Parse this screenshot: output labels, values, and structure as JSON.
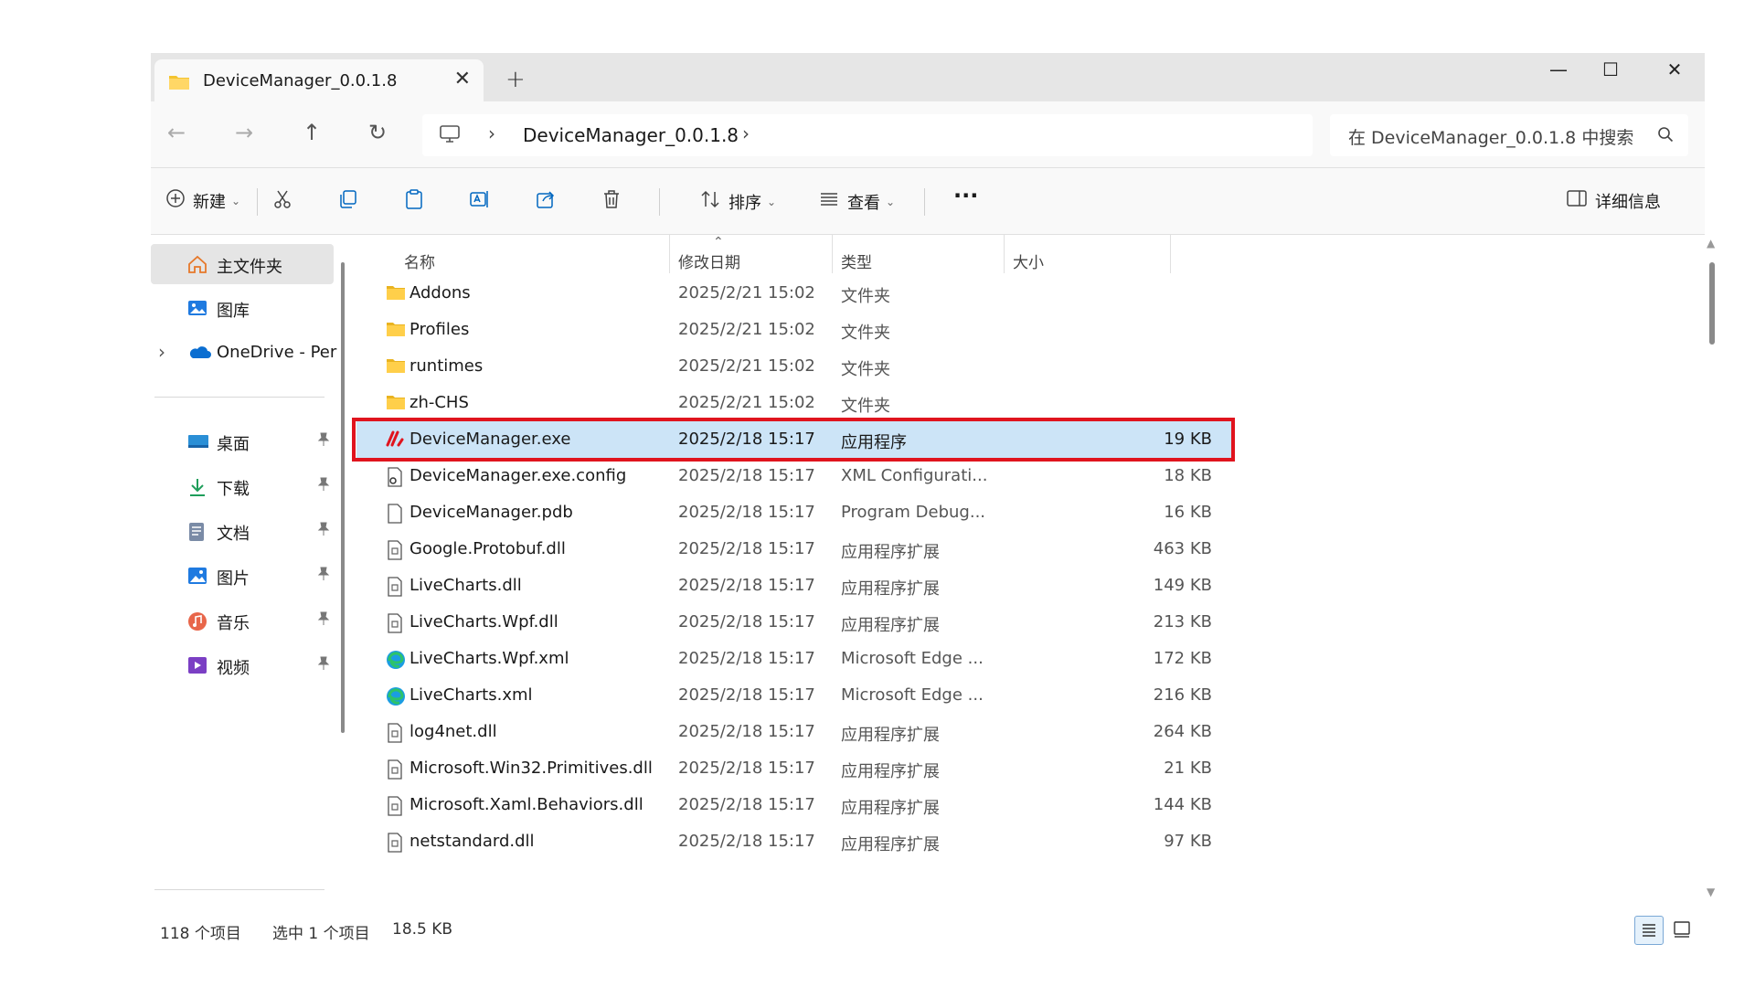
{
  "colors": {
    "selection": "#cce4f7",
    "highlight_border": "#e0141e",
    "folder": "#f4c430",
    "accent": "#0067c0"
  },
  "tab": {
    "title": "DeviceManager_0.0.1.8",
    "close": "✕",
    "new": "+"
  },
  "window_controls": {
    "minimize": "—",
    "maximize": "☐",
    "close": "✕"
  },
  "address": {
    "separator": "›",
    "crumb": "DeviceManager_0.0.1.8",
    "separator_end": "›"
  },
  "search": {
    "placeholder": "在 DeviceManager_0.0.1.8 中搜索"
  },
  "nav_buttons": {
    "back": "←",
    "forward": "→",
    "up": "↑",
    "refresh": "↻"
  },
  "commands": {
    "new": "新建",
    "sort": "排序",
    "view": "查看",
    "more": "···",
    "details": "详细信息"
  },
  "sidebar": {
    "home": "主文件夹",
    "gallery": "图库",
    "onedrive": "OneDrive - Per",
    "expand": "›",
    "quick": [
      {
        "label": "桌面",
        "icon": "desktop-icon"
      },
      {
        "label": "下载",
        "icon": "download-icon"
      },
      {
        "label": "文档",
        "icon": "documents-icon"
      },
      {
        "label": "图片",
        "icon": "pictures-icon"
      },
      {
        "label": "音乐",
        "icon": "music-icon"
      },
      {
        "label": "视频",
        "icon": "videos-icon"
      }
    ]
  },
  "columns": {
    "name": "名称",
    "modified": "修改日期",
    "type": "类型",
    "size": "大小"
  },
  "files": [
    {
      "name": "Addons",
      "date": "2025/2/21 15:02",
      "type": "文件夹",
      "size": "",
      "icon": "folder-icon"
    },
    {
      "name": "Profiles",
      "date": "2025/2/21 15:02",
      "type": "文件夹",
      "size": "",
      "icon": "folder-icon"
    },
    {
      "name": "runtimes",
      "date": "2025/2/21 15:02",
      "type": "文件夹",
      "size": "",
      "icon": "folder-icon"
    },
    {
      "name": "zh-CHS",
      "date": "2025/2/21 15:02",
      "type": "文件夹",
      "size": "",
      "icon": "folder-icon"
    },
    {
      "name": "DeviceManager.exe",
      "date": "2025/2/18 15:17",
      "type": "应用程序",
      "size": "19 KB",
      "icon": "app-exe-icon",
      "selected": true
    },
    {
      "name": "DeviceManager.exe.config",
      "date": "2025/2/18 15:17",
      "type": "XML Configurati...",
      "size": "18 KB",
      "icon": "config-file-icon"
    },
    {
      "name": "DeviceManager.pdb",
      "date": "2025/2/18 15:17",
      "type": "Program Debug...",
      "size": "16 KB",
      "icon": "blank-file-icon"
    },
    {
      "name": "Google.Protobuf.dll",
      "date": "2025/2/18 15:17",
      "type": "应用程序扩展",
      "size": "463 KB",
      "icon": "dll-file-icon"
    },
    {
      "name": "LiveCharts.dll",
      "date": "2025/2/18 15:17",
      "type": "应用程序扩展",
      "size": "149 KB",
      "icon": "dll-file-icon"
    },
    {
      "name": "LiveCharts.Wpf.dll",
      "date": "2025/2/18 15:17",
      "type": "应用程序扩展",
      "size": "213 KB",
      "icon": "dll-file-icon"
    },
    {
      "name": "LiveCharts.Wpf.xml",
      "date": "2025/2/18 15:17",
      "type": "Microsoft Edge ...",
      "size": "172 KB",
      "icon": "edge-icon"
    },
    {
      "name": "LiveCharts.xml",
      "date": "2025/2/18 15:17",
      "type": "Microsoft Edge ...",
      "size": "216 KB",
      "icon": "edge-icon"
    },
    {
      "name": "log4net.dll",
      "date": "2025/2/18 15:17",
      "type": "应用程序扩展",
      "size": "264 KB",
      "icon": "dll-file-icon"
    },
    {
      "name": "Microsoft.Win32.Primitives.dll",
      "date": "2025/2/18 15:17",
      "type": "应用程序扩展",
      "size": "21 KB",
      "icon": "dll-file-icon"
    },
    {
      "name": "Microsoft.Xaml.Behaviors.dll",
      "date": "2025/2/18 15:17",
      "type": "应用程序扩展",
      "size": "144 KB",
      "icon": "dll-file-icon"
    },
    {
      "name": "netstandard.dll",
      "date": "2025/2/18 15:17",
      "type": "应用程序扩展",
      "size": "97 KB",
      "icon": "dll-file-icon"
    }
  ],
  "status": {
    "count": "118 个项目",
    "selected": "选中 1 个项目",
    "size": "18.5 KB"
  }
}
